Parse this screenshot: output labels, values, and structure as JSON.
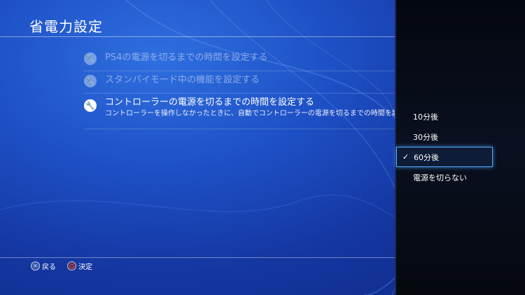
{
  "header": {
    "title": "省電力設定"
  },
  "menu": {
    "items": [
      {
        "label": "PS4の電源を切るまでの時間を設定する",
        "state": "disabled",
        "icon": "wrench-icon"
      },
      {
        "label": "スタンバイモード中の機能を設定する",
        "state": "disabled",
        "icon": "wrench-icon"
      },
      {
        "label": "コントローラーの電源を切るまでの時間を設定する",
        "description": "コントローラーを操作しなかったときに、自動でコントローラーの電源を切るまでの時間を設定しま",
        "state": "active",
        "icon": "wrench-icon"
      }
    ]
  },
  "footer": {
    "back": {
      "icon": "cross-button-icon",
      "label": "戻る"
    },
    "confirm": {
      "icon": "circle-button-icon",
      "label": "決定"
    }
  },
  "options_panel": {
    "options": [
      {
        "label": "10分後",
        "selected": false
      },
      {
        "label": "30分後",
        "selected": false
      },
      {
        "label": "60分後",
        "selected": true
      },
      {
        "label": "電源を切らない",
        "selected": false
      }
    ]
  },
  "colors": {
    "background": "#1d4fc4",
    "panel": "#0a1020",
    "focus": "#4fa8ff"
  }
}
